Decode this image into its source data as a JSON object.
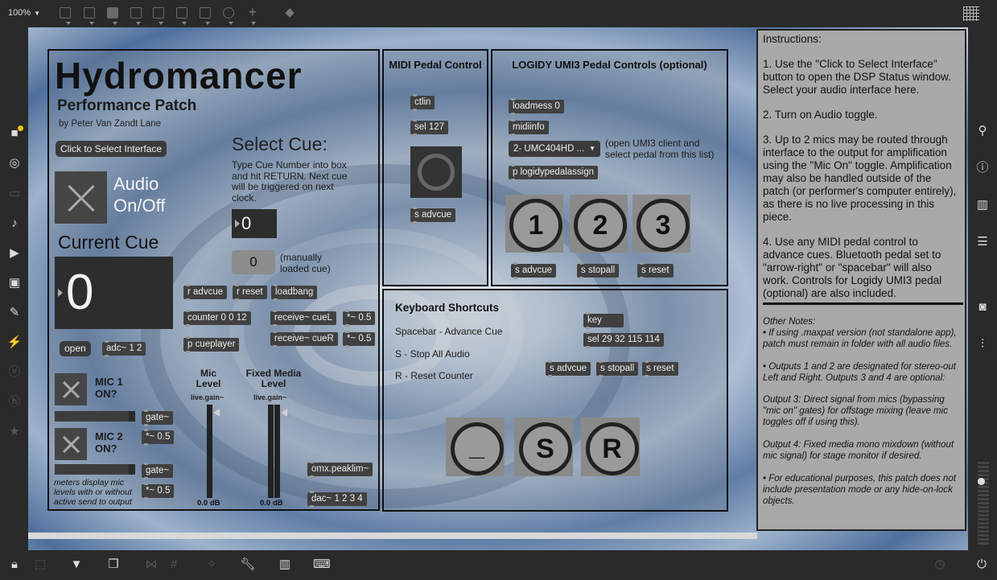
{
  "toolbar": {
    "zoom": "100%",
    "icons": [
      "presentation-icon",
      "comment-icon",
      "message-icon",
      "button-x-icon",
      "toggle-icon",
      "panel-icon",
      "slider-icon",
      "dial-icon",
      "plus-icon",
      "paint-bucket-icon"
    ]
  },
  "left_sidebar": {
    "icons": [
      "objects-icon",
      "target-icon",
      "ruler-icon",
      "music-note-icon",
      "step-play-icon",
      "image-icon",
      "paperclip-icon",
      "plug-icon",
      "v-icon",
      "h-icon",
      "star-icon"
    ]
  },
  "right_sidebar": {
    "icons": [
      "search-icon",
      "info-icon",
      "book-icon",
      "list-icon",
      "camera-icon",
      "sliders-icon"
    ]
  },
  "bottom_toolbar": {
    "icons": [
      "lock-icon",
      "edit-icon",
      "presentation-icon",
      "windows-icon",
      "patch-cords-icon",
      "grid-icon",
      "wand-icon",
      "wrench-icon",
      "piano-icon",
      "keyboard-icon",
      "clock-play-icon",
      "power-icon"
    ]
  },
  "main_panel": {
    "title": "Hydromancer",
    "subtitle": "Performance Patch",
    "author": "by Peter Van Zandt Lane",
    "select_interface_button": "Click to Select Interface",
    "audio_label": "Audio On/Off",
    "current_cue_label": "Current Cue",
    "current_cue_value": "0",
    "select_cue_label": "Select Cue:",
    "select_cue_help": "Type Cue Number into box and hit RETURN. Next cue will be triggered on next clock.",
    "select_cue_value": "0",
    "manual_cue_value": "0",
    "manual_cue_note": "(manually loaded cue)",
    "open_button": "open",
    "objects": {
      "adc": "adc~ 1 2",
      "r_advcue": "r advcue",
      "r_reset": "r reset",
      "loadbang": "loadbang",
      "counter": "counter 0 0 12",
      "receive_cueL": "receive~ cueL",
      "receive_cueR": "receive~ cueR",
      "mult1": "*~ 0.5",
      "mult2": "*~ 0.5",
      "p_cueplayer": "p cueplayer",
      "gate1": "gate~",
      "mult3": "*~ 0.5",
      "gate2": "gate~",
      "mult4": "*~ 0.5",
      "omx": "omx.peaklim~",
      "dac": "dac~ 1 2 3 4"
    },
    "mic1_label": "MIC 1 ON?",
    "mic2_label": "MIC 2 ON?",
    "meters_note": "meters display mic levels with or without active send to output",
    "mic_level_label": "Mic Level",
    "fixed_media_label": "Fixed Media Level",
    "gain_name": "live.gain~",
    "mic_gain_value": "0.0 dB",
    "fixed_gain_value": "0.0 dB"
  },
  "midi_panel": {
    "title": "MIDI Pedal Control",
    "ctlin": "ctlin",
    "sel": "sel 127",
    "send": "s advcue"
  },
  "logidy_panel": {
    "title": "LOGIDY UMI3 Pedal Controls (optional)",
    "loadmess": "loadmess 0",
    "midiinfo": "midiinfo",
    "device_menu": "2- UMC404HD ...",
    "device_note": "(open UMI3 client and select pedal from this list)",
    "assign": "p logidypedalassign",
    "pedals": [
      "1",
      "2",
      "3"
    ],
    "sends": [
      "s advcue",
      "s stopall",
      "s reset"
    ]
  },
  "keyboard_panel": {
    "title": "Keyboard Shortcuts",
    "shortcuts": [
      "Spacebar - Advance Cue",
      "S - Stop All Audio",
      "R - Reset Counter"
    ],
    "key_object": "key",
    "sel_object": "sel 29 32 115 114",
    "sends": [
      "s advcue",
      "s stopall",
      "s reset"
    ],
    "buttons": [
      "_",
      "S",
      "R"
    ]
  },
  "instructions": {
    "heading": "Instructions:",
    "steps": [
      "1. Use the \"Click to Select Interface\" button to open the DSP Status window. Select your audio interface here.",
      "2. Turn on Audio toggle.",
      "3. Up to 2 mics may be routed through interface to the output for amplification using the \"Mic On\" toggle. Amplification may also be handled outside of the patch (or performer's computer entirely), as there is no live processing in this piece.",
      "4. Use any MIDI pedal control to advance cues. Bluetooth pedal set to \"arrow-right\" or \"spacebar\" will also work. Controls for Logidy UMI3 pedal (optional) are also included."
    ],
    "other_heading": "Other Notes:",
    "notes": [
      "• If using .maxpat version (not standalone app), patch must remain in folder with all audio files.",
      "• Outputs 1 and 2 are designated for stereo-out Left and Right. Outputs 3 and 4 are optional:",
      "Output 3: Direct signal from mics (bypassing \"mic on\" gates) for offstage mixing (leave mic toggles off if using this).",
      "Output 4: Fixed media mono mixdown (without mic signal) for stage monitor if desired.",
      "• For educational purposes, this patch does not include presentation mode or any hide-on-lock objects."
    ]
  }
}
